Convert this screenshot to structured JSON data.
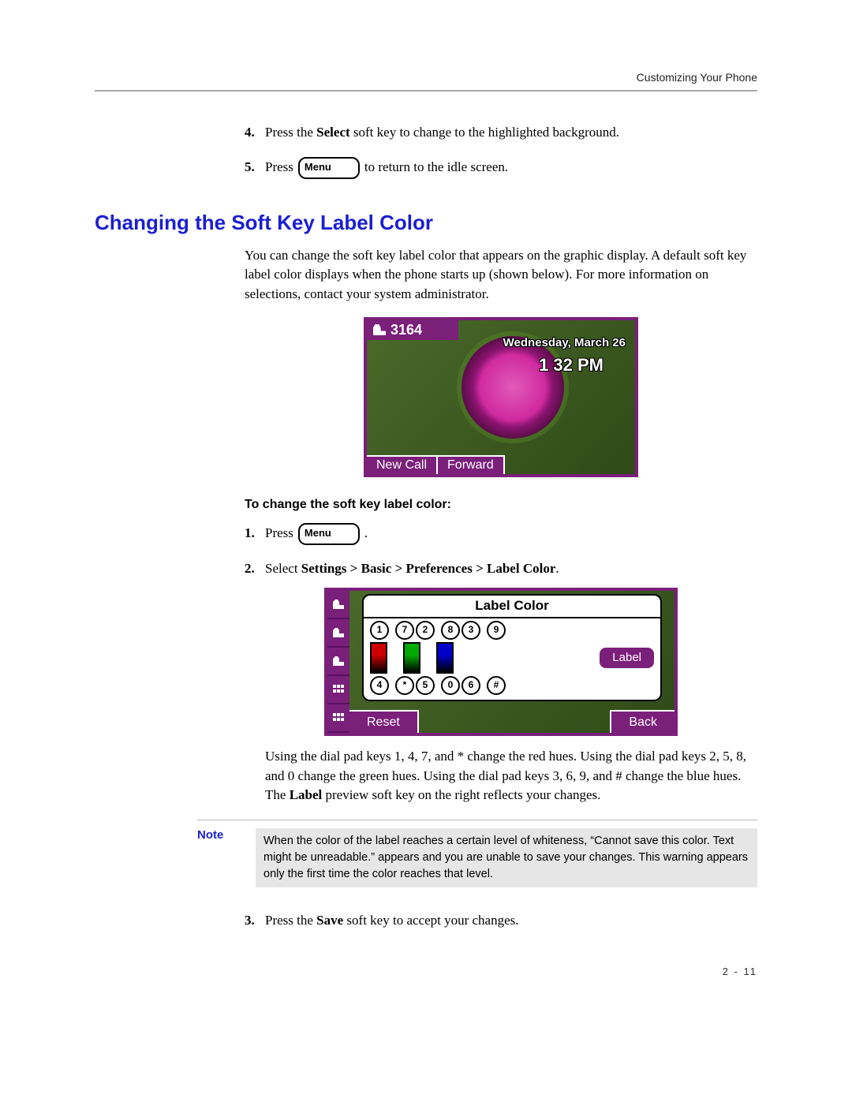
{
  "running_head": "Customizing Your Phone",
  "steps_a": {
    "4": {
      "pre": "Press the ",
      "bold": "Select",
      "post": " soft key to change to the highlighted background."
    },
    "5": {
      "pre": "Press ",
      "key": "Menu",
      "post": " to return to the idle screen."
    }
  },
  "section_title": "Changing the Soft Key Label Color",
  "intro": "You can change the soft key label color that appears on the graphic display. A default soft key label color displays when the phone starts up (shown below). For more information on selections, contact your system administrator.",
  "phone1": {
    "line": "3164",
    "date": "Wednesday, March 26",
    "time": "1 32 PM",
    "sk1": "New Call",
    "sk2": "Forward"
  },
  "subhead": "To change the soft key label color:",
  "steps_b": {
    "1": {
      "pre": "Press ",
      "key": "Menu",
      "post": " ."
    },
    "2": {
      "pre": "Select ",
      "bold": "Settings > Basic > Preferences > Label Color",
      "post": "."
    },
    "2_after": {
      "text": "Using the dial pad keys 1, 4, 7, and * change the red hues. Using the dial pad keys 2, 5, 8, and 0 change the green hues. Using the dial pad keys 3, 6, 9, and # change the blue hues. The ",
      "bold": "Label",
      "tail": " preview soft key on the right reflects your changes."
    },
    "3": {
      "pre": "Press the ",
      "bold": "Save",
      "post": " soft key to accept your changes."
    }
  },
  "phone2": {
    "title": "Label Color",
    "nums_row1": [
      "1",
      "7",
      "2",
      "8",
      "3",
      "9"
    ],
    "nums_row3": [
      "4",
      "*",
      "5",
      "0",
      "6",
      "#"
    ],
    "label_btn": "Label",
    "sk_left": "Reset",
    "sk_right": "Back"
  },
  "note": {
    "label": "Note",
    "text": "When the color of the label reaches a certain level of whiteness, “Cannot save this color. Text might be unreadable.” appears and you are unable to save your changes. This warning appears only the first time the color reaches that level."
  },
  "page_number": "2 - 11"
}
